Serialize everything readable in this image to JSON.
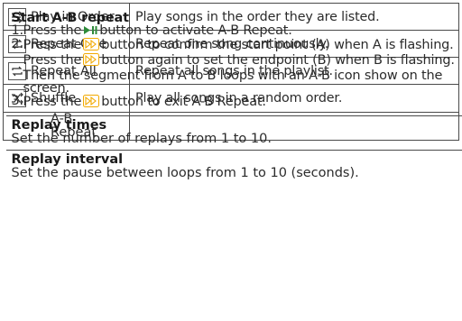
{
  "modes": [
    {
      "icon": "play-in-order-icon",
      "label": "Play in Order",
      "desc": "Play songs in the order they are listed."
    },
    {
      "icon": "repeat-one-icon",
      "label": "Repeat One",
      "desc": "Repeat one song continuously."
    },
    {
      "icon": "repeat-all-icon",
      "label": "Repeat All",
      "desc": "Repeat all songs in the playlist."
    },
    {
      "icon": "shuffle-icon",
      "label": "Shuffle",
      "desc": "Play all songs in a random order."
    }
  ],
  "ab": {
    "mode_label_1": "A-B",
    "mode_label_2": "Repeat",
    "heading": "Start A-B repeat",
    "step1_num": "1.",
    "step1_pre": "Press the",
    "step1_post": "button to activate A-B Repeat.",
    "step2_num": "2.",
    "step2_a": "Press the",
    "step2_b": "button to confirm the start point (A) when A is flashing. Press the",
    "step2_c": "button again to set the endpoint (B) when B is flashing. Then the segment from A to B loops with an A-B icon show on the screen.",
    "step3_num": "3.",
    "step3_pre": "Press the",
    "step3_post": "button to exit A-B Repeat.",
    "replay_times_heading": "Replay times",
    "replay_times_desc": "Set the number of replays from 1 to 10.",
    "replay_interval_heading": "Replay interval",
    "replay_interval_desc": "Set the pause between loops from 1 to 10 (seconds).",
    "accent_color": "#2e8b3a",
    "button_icon_color": "#f2a900"
  }
}
